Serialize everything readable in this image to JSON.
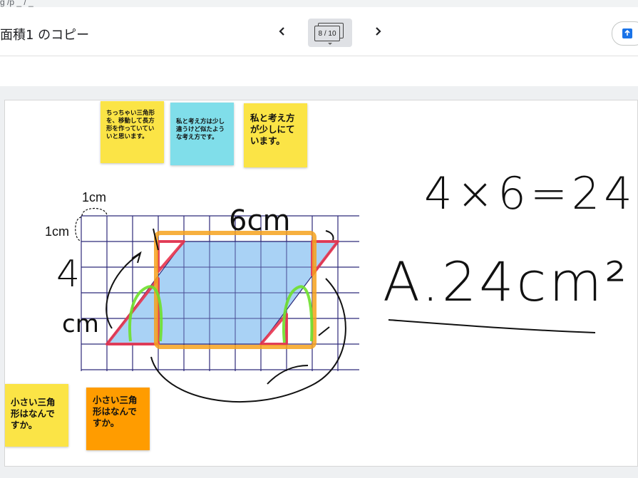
{
  "browser": {
    "url_fragment": "g       /p              _              /              _"
  },
  "header": {
    "title": "面積1 のコピー",
    "prev_icon": "chevron-left-icon",
    "next_icon": "chevron-right-icon",
    "page_indicator": "8 / 10",
    "share_icon": "present-upload-icon"
  },
  "stickies": [
    {
      "id": "note1",
      "text": "ちっちゃい三角形を、移動して長方形を作っていていいと思います。",
      "color": "#fbe446"
    },
    {
      "id": "note2",
      "text": "私と考え方は少し違うけど似たような考え方です。",
      "color": "#80deea"
    },
    {
      "id": "note3",
      "text": "私と考え方が少しにています。",
      "color": "#fbe446"
    },
    {
      "id": "note4",
      "text": "小さい三角形はなんですか。",
      "color": "#fbe446"
    },
    {
      "id": "note5",
      "text": "小さい三角形はなんですか。",
      "color": "#ff9c00"
    }
  ],
  "worksheet": {
    "unit_label_top": "1cm",
    "unit_label_side": "1cm",
    "height_label": "4",
    "height_unit": "cm",
    "base_label": "6cm"
  },
  "handwriting": {
    "equation": "4×6=24",
    "answer": "A.24cm²"
  },
  "colors": {
    "parallelogram_fill": "#a9d2f5",
    "grid_line": "#2e2a7a",
    "highlight_orange": "#f6a21d",
    "highlight_red": "#e8344e",
    "highlight_green": "#6ee02b"
  }
}
